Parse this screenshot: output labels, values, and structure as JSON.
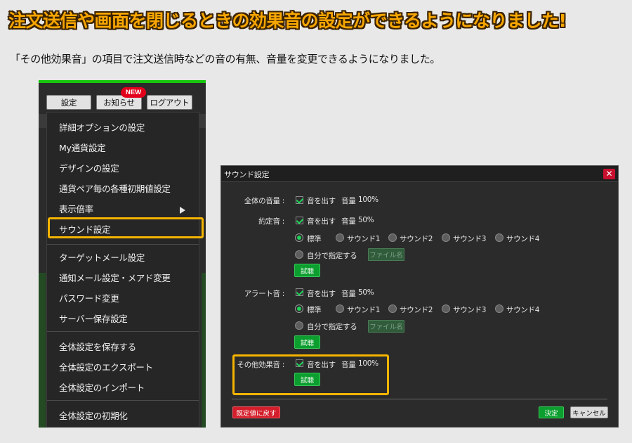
{
  "headline": "注文送信や画面を閉じるときの効果音の設定ができるようになりました!",
  "lead": "「その他効果音」の項目で注文送信時などの音の有無、音量を変更できるようになりました。",
  "colors": {
    "headline": "#f7a600",
    "highlight": "#f5b400",
    "accent_green": "#16c60c",
    "danger": "#d41e2b"
  },
  "menu": {
    "top_buttons": {
      "settings": "設定",
      "notice": "お知らせ",
      "logout": "ログアウト"
    },
    "new_badge": "NEW",
    "items": [
      "詳細オプションの設定",
      "My通貨設定",
      "デザインの設定",
      "通貨ペア毎の各種初期値設定",
      "表示倍率",
      "サウンド設定",
      "ターゲットメール設定",
      "通知メール設定・メアド変更",
      "パスワード変更",
      "サーバー保存設定",
      "全体設定を保存する",
      "全体設定のエクスポート",
      "全体設定のインポート",
      "全体設定の初期化"
    ],
    "submenu_icon": "triangle-right-icon"
  },
  "dialog": {
    "title": "サウンド設定",
    "close_icon": "close-icon",
    "overall": {
      "label": "全体の音量 :",
      "checkbox": "音を出す",
      "volume_label": "音量",
      "volume": "100%"
    },
    "execution": {
      "label": "約定音 :",
      "checkbox": "音を出す",
      "volume_label": "音量",
      "volume": "50%",
      "options": [
        "標準",
        "サウンド1",
        "サウンド2",
        "サウンド3",
        "サウンド4"
      ],
      "selected": "標準",
      "custom": "自分で指定する",
      "file_button": "ファイル名",
      "try_button": "試聴"
    },
    "alert": {
      "label": "アラート音 :",
      "checkbox": "音を出す",
      "volume_label": "音量",
      "volume": "50%",
      "options": [
        "標準",
        "サウンド1",
        "サウンド2",
        "サウンド3",
        "サウンド4"
      ],
      "selected": "標準",
      "custom": "自分で指定する",
      "file_button": "ファイル名",
      "try_button": "試聴"
    },
    "other": {
      "label": "その他効果音 :",
      "checkbox": "音を出す",
      "volume_label": "音量",
      "volume": "100%",
      "try_button": "試聴"
    },
    "reset_button": "既定値に戻す",
    "ok_button": "決定",
    "cancel_button": "キャンセル"
  }
}
